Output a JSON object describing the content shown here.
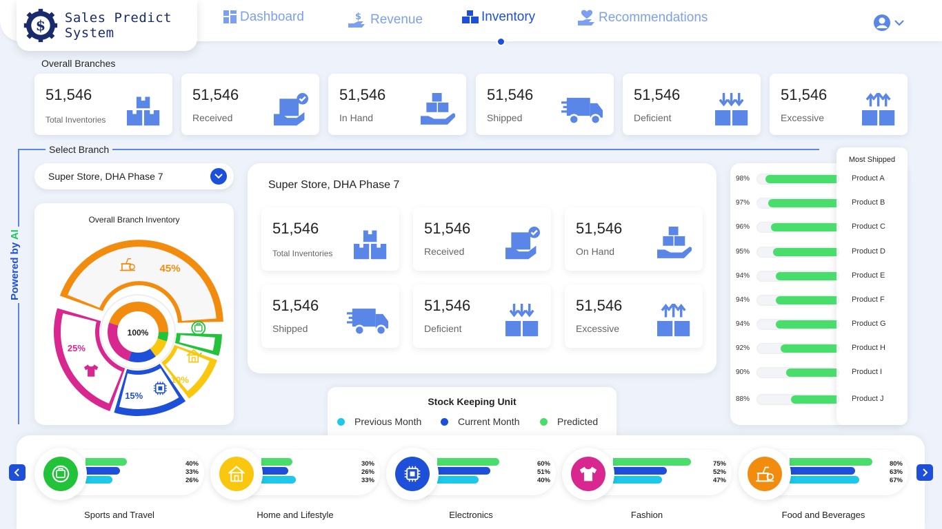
{
  "app": {
    "title": "Sales Predict System"
  },
  "nav": [
    {
      "label": "Dashboard",
      "icon": "dashboard-icon"
    },
    {
      "label": "Revenue",
      "icon": "revenue-icon"
    },
    {
      "label": "Inventory",
      "icon": "inventory-icon",
      "active": true
    },
    {
      "label": "Recommendations",
      "icon": "recommendations-icon"
    }
  ],
  "overall": {
    "title": "Overall Branches",
    "cards": [
      {
        "value": "51,546",
        "label": "Total Inventories",
        "icon": "boxes-icon"
      },
      {
        "value": "51,546",
        "label": "Received",
        "icon": "box-check-icon"
      },
      {
        "value": "51,546",
        "label": "In Hand",
        "icon": "box-hand-icon"
      },
      {
        "value": "51,546",
        "label": "Shipped",
        "icon": "truck-icon"
      },
      {
        "value": "51,546",
        "label": "Deficient",
        "icon": "boxes-down-icon"
      },
      {
        "value": "51,546",
        "label": "Excessive",
        "icon": "boxes-up-icon"
      }
    ]
  },
  "branch": {
    "title": "Select Branch",
    "selected": "Super Store, DHA Phase 7",
    "powered": "Powered by",
    "powered_ai": "AI",
    "panel_title": "Super Store, DHA Phase 7",
    "cards": [
      {
        "value": "51,546",
        "label": "Total Inventories"
      },
      {
        "value": "51,546",
        "label": "Received"
      },
      {
        "value": "51,546",
        "label": "On Hand"
      },
      {
        "value": "51,546",
        "label": "Shipped"
      },
      {
        "value": "51,546",
        "label": "Deficient"
      },
      {
        "value": "51,546",
        "label": "Excessive"
      }
    ]
  },
  "chart_data": [
    {
      "type": "pie",
      "title": "Overall Branch Inventory",
      "center_label": "100%",
      "slices": [
        {
          "label": "45%",
          "value": 45,
          "color": "#f28c0f",
          "icon": "food-icon"
        },
        {
          "label": "5%",
          "value": 5,
          "color": "#22c33a",
          "icon": "sports-icon"
        },
        {
          "label": "10%",
          "value": 10,
          "color": "#f9c80e",
          "icon": "home-icon"
        },
        {
          "label": "15%",
          "value": 15,
          "color": "#1d4fd8",
          "icon": "electronics-icon"
        },
        {
          "label": "25%",
          "value": 25,
          "color": "#d8278f",
          "icon": "fashion-icon"
        }
      ]
    },
    {
      "type": "bar",
      "title": "Most Shipped",
      "categories": [
        "Product A",
        "Product B",
        "Product C",
        "Product D",
        "Product E",
        "Product F",
        "Product G",
        "Product H",
        "Product I",
        "Product J"
      ],
      "values": [
        98,
        97,
        96,
        95,
        94,
        94,
        94,
        92,
        90,
        88
      ],
      "labels": [
        "98%",
        "97%",
        "96%",
        "95%",
        "94%",
        "94%",
        "94%",
        "92%",
        "90%",
        "88%"
      ],
      "color": "#49dd6b"
    },
    {
      "type": "bar",
      "title": "Stock Keeping Unit",
      "categories": [
        "Sports and Travel",
        "Home and Lifestyle",
        "Electronics",
        "Fashion",
        "Food and Beverages"
      ],
      "series": [
        {
          "name": "Predicted",
          "values": [
            40,
            30,
            60,
            75,
            80
          ],
          "labels": [
            "40%",
            "30%",
            "60%",
            "75%",
            "80%"
          ],
          "color": "#49dd6b"
        },
        {
          "name": "Current Month",
          "values": [
            33,
            26,
            51,
            52,
            63
          ],
          "labels": [
            "33%",
            "26%",
            "51%",
            "52%",
            "63%"
          ],
          "color": "#1d4fd8"
        },
        {
          "name": "Previous Month",
          "values": [
            26,
            33,
            40,
            47,
            67
          ],
          "labels": [
            "26%",
            "33%",
            "40%",
            "47%",
            "67%"
          ],
          "color": "#1ec8e8"
        }
      ]
    }
  ],
  "sku": {
    "title": "Stock Keeping Unit",
    "legend": [
      {
        "label": "Previous Month",
        "color": "#1ec8e8"
      },
      {
        "label": "Current Month",
        "color": "#1d4fd8"
      },
      {
        "label": "Predicted",
        "color": "#49dd6b"
      }
    ]
  },
  "categories": [
    {
      "name": "Sports and Travel",
      "color": "#22c33a",
      "icon": "sports-icon"
    },
    {
      "name": "Home and Lifestyle",
      "color": "#f9c80e",
      "icon": "home-icon"
    },
    {
      "name": "Electronics",
      "color": "#1d4fd8",
      "icon": "electronics-icon"
    },
    {
      "name": "Fashion",
      "color": "#d8278f",
      "icon": "fashion-icon"
    },
    {
      "name": "Food and Beverages",
      "color": "#f28c0f",
      "icon": "food-icon"
    }
  ]
}
